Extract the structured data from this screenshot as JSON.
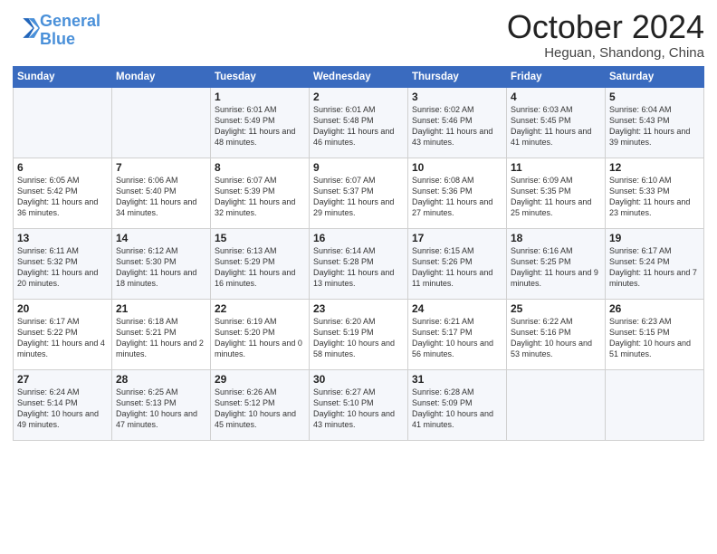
{
  "logo": {
    "line1": "General",
    "line2": "Blue"
  },
  "title": "October 2024",
  "location": "Heguan, Shandong, China",
  "days_of_week": [
    "Sunday",
    "Monday",
    "Tuesday",
    "Wednesday",
    "Thursday",
    "Friday",
    "Saturday"
  ],
  "weeks": [
    [
      {
        "day": "",
        "info": ""
      },
      {
        "day": "",
        "info": ""
      },
      {
        "day": "1",
        "info": "Sunrise: 6:01 AM\nSunset: 5:49 PM\nDaylight: 11 hours and 48 minutes."
      },
      {
        "day": "2",
        "info": "Sunrise: 6:01 AM\nSunset: 5:48 PM\nDaylight: 11 hours and 46 minutes."
      },
      {
        "day": "3",
        "info": "Sunrise: 6:02 AM\nSunset: 5:46 PM\nDaylight: 11 hours and 43 minutes."
      },
      {
        "day": "4",
        "info": "Sunrise: 6:03 AM\nSunset: 5:45 PM\nDaylight: 11 hours and 41 minutes."
      },
      {
        "day": "5",
        "info": "Sunrise: 6:04 AM\nSunset: 5:43 PM\nDaylight: 11 hours and 39 minutes."
      }
    ],
    [
      {
        "day": "6",
        "info": "Sunrise: 6:05 AM\nSunset: 5:42 PM\nDaylight: 11 hours and 36 minutes."
      },
      {
        "day": "7",
        "info": "Sunrise: 6:06 AM\nSunset: 5:40 PM\nDaylight: 11 hours and 34 minutes."
      },
      {
        "day": "8",
        "info": "Sunrise: 6:07 AM\nSunset: 5:39 PM\nDaylight: 11 hours and 32 minutes."
      },
      {
        "day": "9",
        "info": "Sunrise: 6:07 AM\nSunset: 5:37 PM\nDaylight: 11 hours and 29 minutes."
      },
      {
        "day": "10",
        "info": "Sunrise: 6:08 AM\nSunset: 5:36 PM\nDaylight: 11 hours and 27 minutes."
      },
      {
        "day": "11",
        "info": "Sunrise: 6:09 AM\nSunset: 5:35 PM\nDaylight: 11 hours and 25 minutes."
      },
      {
        "day": "12",
        "info": "Sunrise: 6:10 AM\nSunset: 5:33 PM\nDaylight: 11 hours and 23 minutes."
      }
    ],
    [
      {
        "day": "13",
        "info": "Sunrise: 6:11 AM\nSunset: 5:32 PM\nDaylight: 11 hours and 20 minutes."
      },
      {
        "day": "14",
        "info": "Sunrise: 6:12 AM\nSunset: 5:30 PM\nDaylight: 11 hours and 18 minutes."
      },
      {
        "day": "15",
        "info": "Sunrise: 6:13 AM\nSunset: 5:29 PM\nDaylight: 11 hours and 16 minutes."
      },
      {
        "day": "16",
        "info": "Sunrise: 6:14 AM\nSunset: 5:28 PM\nDaylight: 11 hours and 13 minutes."
      },
      {
        "day": "17",
        "info": "Sunrise: 6:15 AM\nSunset: 5:26 PM\nDaylight: 11 hours and 11 minutes."
      },
      {
        "day": "18",
        "info": "Sunrise: 6:16 AM\nSunset: 5:25 PM\nDaylight: 11 hours and 9 minutes."
      },
      {
        "day": "19",
        "info": "Sunrise: 6:17 AM\nSunset: 5:24 PM\nDaylight: 11 hours and 7 minutes."
      }
    ],
    [
      {
        "day": "20",
        "info": "Sunrise: 6:17 AM\nSunset: 5:22 PM\nDaylight: 11 hours and 4 minutes."
      },
      {
        "day": "21",
        "info": "Sunrise: 6:18 AM\nSunset: 5:21 PM\nDaylight: 11 hours and 2 minutes."
      },
      {
        "day": "22",
        "info": "Sunrise: 6:19 AM\nSunset: 5:20 PM\nDaylight: 11 hours and 0 minutes."
      },
      {
        "day": "23",
        "info": "Sunrise: 6:20 AM\nSunset: 5:19 PM\nDaylight: 10 hours and 58 minutes."
      },
      {
        "day": "24",
        "info": "Sunrise: 6:21 AM\nSunset: 5:17 PM\nDaylight: 10 hours and 56 minutes."
      },
      {
        "day": "25",
        "info": "Sunrise: 6:22 AM\nSunset: 5:16 PM\nDaylight: 10 hours and 53 minutes."
      },
      {
        "day": "26",
        "info": "Sunrise: 6:23 AM\nSunset: 5:15 PM\nDaylight: 10 hours and 51 minutes."
      }
    ],
    [
      {
        "day": "27",
        "info": "Sunrise: 6:24 AM\nSunset: 5:14 PM\nDaylight: 10 hours and 49 minutes."
      },
      {
        "day": "28",
        "info": "Sunrise: 6:25 AM\nSunset: 5:13 PM\nDaylight: 10 hours and 47 minutes."
      },
      {
        "day": "29",
        "info": "Sunrise: 6:26 AM\nSunset: 5:12 PM\nDaylight: 10 hours and 45 minutes."
      },
      {
        "day": "30",
        "info": "Sunrise: 6:27 AM\nSunset: 5:10 PM\nDaylight: 10 hours and 43 minutes."
      },
      {
        "day": "31",
        "info": "Sunrise: 6:28 AM\nSunset: 5:09 PM\nDaylight: 10 hours and 41 minutes."
      },
      {
        "day": "",
        "info": ""
      },
      {
        "day": "",
        "info": ""
      }
    ]
  ]
}
